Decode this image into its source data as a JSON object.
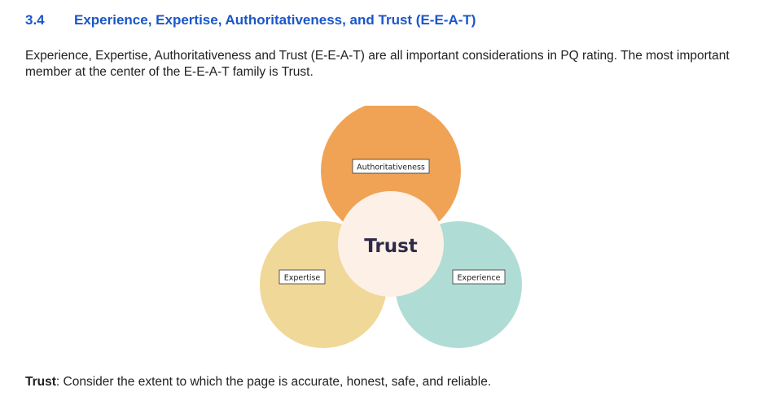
{
  "section": {
    "number": "3.4",
    "title": "Experience, Expertise, Authoritativeness, and Trust (E-E-A-T)"
  },
  "intro_text": "Experience, Expertise, Authoritativeness and Trust (E-E-A-T) are all important considerations in PQ rating.  The most important member at the center of the E-E-A-T family is Trust.",
  "diagram": {
    "center_label": "Trust",
    "top_label": "Authoritativeness",
    "left_label": "Expertise",
    "right_label": "Experience",
    "colors": {
      "top_circle": "#f0a050",
      "left_circle": "#f0d898",
      "right_circle": "#b0dcd6",
      "center_circle": "#fdf0e6",
      "center_text": "#2e2a4a",
      "label_box_border": "#333333"
    }
  },
  "trust_definition": {
    "term": "Trust",
    "text": ": Consider the extent to which the page is accurate, honest, safe, and reliable."
  }
}
